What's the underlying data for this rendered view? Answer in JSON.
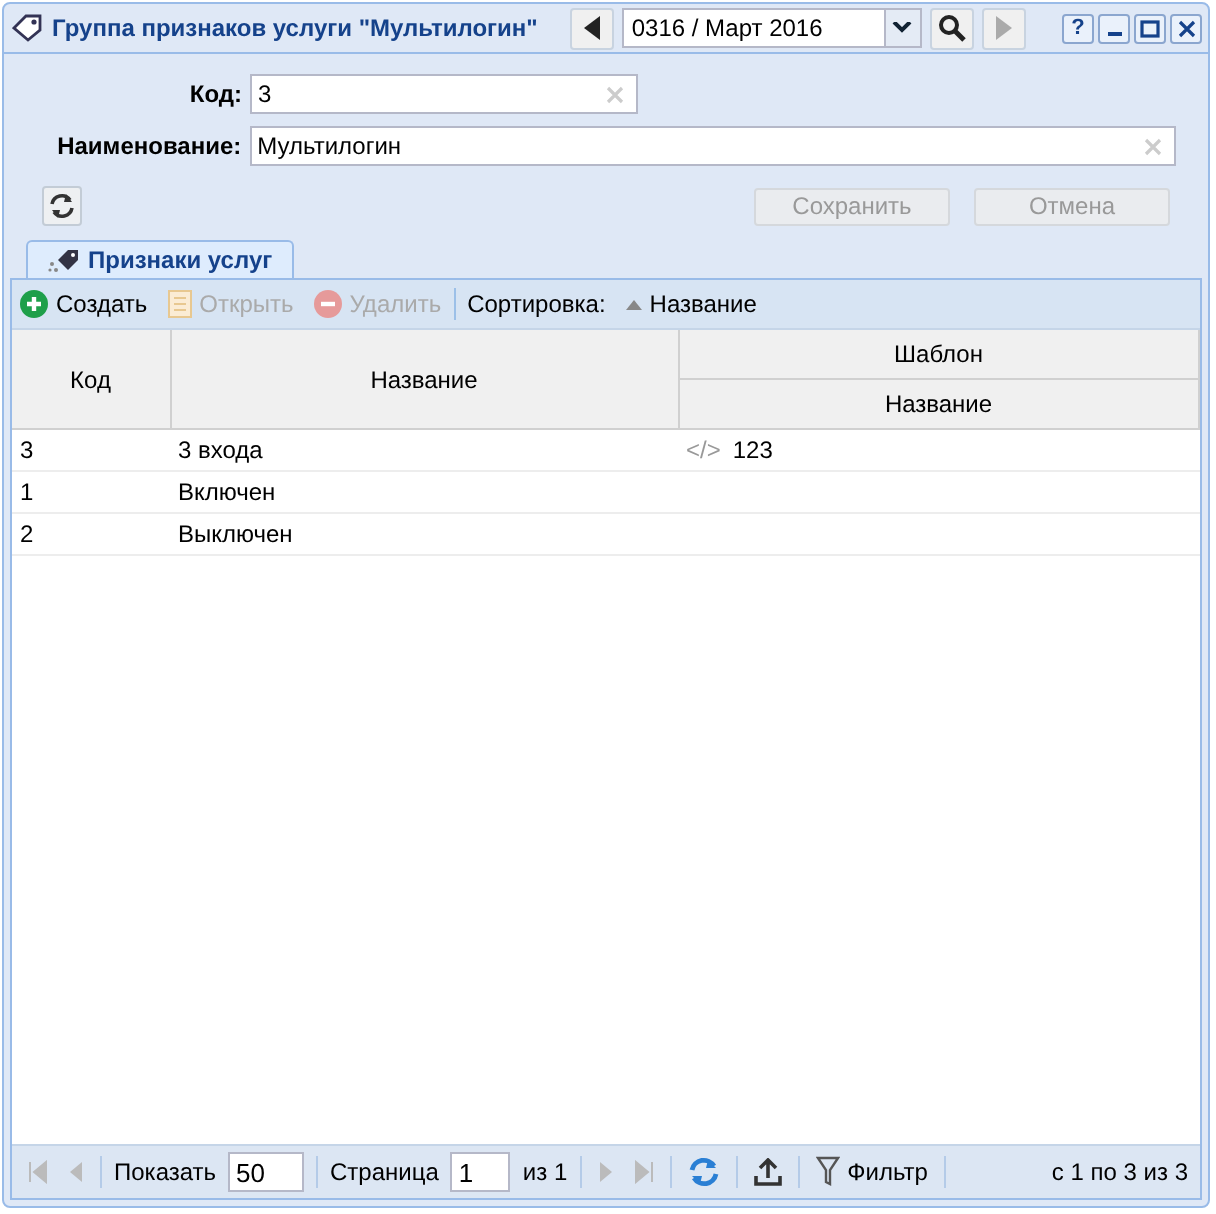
{
  "window": {
    "title": "Группа признаков услуги \"Мультилогин\"",
    "period": "0316 / Март 2016",
    "prev_disabled": false,
    "next_disabled": true,
    "controls": [
      "?"
    ]
  },
  "form": {
    "fields": [
      {
        "label": "Код:",
        "value": "3",
        "kind": "short"
      },
      {
        "label": "Наименование:",
        "value": "Мультилогин",
        "kind": "wide"
      }
    ],
    "buttons": [
      {
        "label": "Сохранить",
        "disabled": true
      },
      {
        "label": "Отмена",
        "disabled": true
      }
    ]
  },
  "tabs": [
    {
      "label": "Признаки услуг",
      "selected": true
    }
  ],
  "toolbar": {
    "actions": [
      {
        "label": "Создать",
        "kind": "add",
        "disabled": false
      },
      {
        "label": "Открыть",
        "kind": "open",
        "disabled": true
      },
      {
        "label": "Удалить",
        "kind": "delete",
        "disabled": true
      }
    ],
    "sort_label": "Сортировка:",
    "sort_field": "Название"
  },
  "table": {
    "columns": [
      "Код",
      "Название"
    ],
    "group": {
      "label": "Шаблон",
      "columns": [
        "Название"
      ]
    },
    "rows": [
      {
        "cells": [
          "3",
          "3 входа"
        ],
        "template": {
          "icon": "</>",
          "value": "123"
        }
      },
      {
        "cells": [
          "1",
          "Включен"
        ]
      },
      {
        "cells": [
          "2",
          "Выключен"
        ]
      }
    ]
  },
  "paging": {
    "show_label": "Показать",
    "page_size": "50",
    "page_label": "Страница",
    "page": "1",
    "of": "из 1",
    "filter": "Фильтр",
    "summary": "с 1 по 3 из 3",
    "first_disabled": true,
    "last_disabled": true
  }
}
